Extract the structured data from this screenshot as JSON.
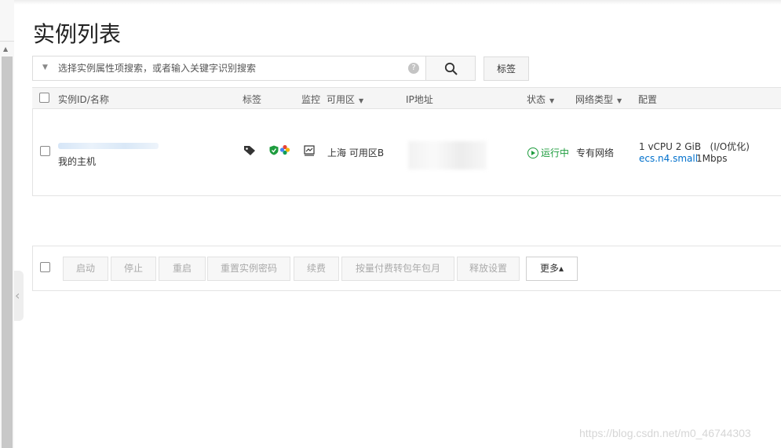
{
  "page": {
    "title": "实例列表"
  },
  "search": {
    "placeholder": "选择实例属性项搜索，或者输入关键字识别搜索",
    "help": "?"
  },
  "toolbar": {
    "tag_label": "标签"
  },
  "table": {
    "columns": {
      "id_name": "实例ID/名称",
      "tags": "标签",
      "monitor": "监控",
      "zone": "可用区",
      "ip": "IP地址",
      "status": "状态",
      "network": "网络类型",
      "config": "配置"
    },
    "rows": [
      {
        "name": "我的主机",
        "zone": "上海 可用区B",
        "status": "运行中",
        "network": "专有网络",
        "config_line1": "1 vCPU 2 GiB",
        "config_opt": "(I/O优化)",
        "instance_type": "ecs.n4.small",
        "bandwidth": "1Mbps"
      }
    ]
  },
  "actions": {
    "start": "启动",
    "stop": "停止",
    "restart": "重启",
    "reset_password": "重置实例密码",
    "renew": "续费",
    "convert_billing": "按量付费转包年包月",
    "release_settings": "释放设置",
    "more": "更多▴"
  },
  "watermark": "https://blog.csdn.net/m0_46744303",
  "colors": {
    "link": "#0070cc",
    "running": "#1e9c3e",
    "header_bg": "#f5f5f5"
  }
}
